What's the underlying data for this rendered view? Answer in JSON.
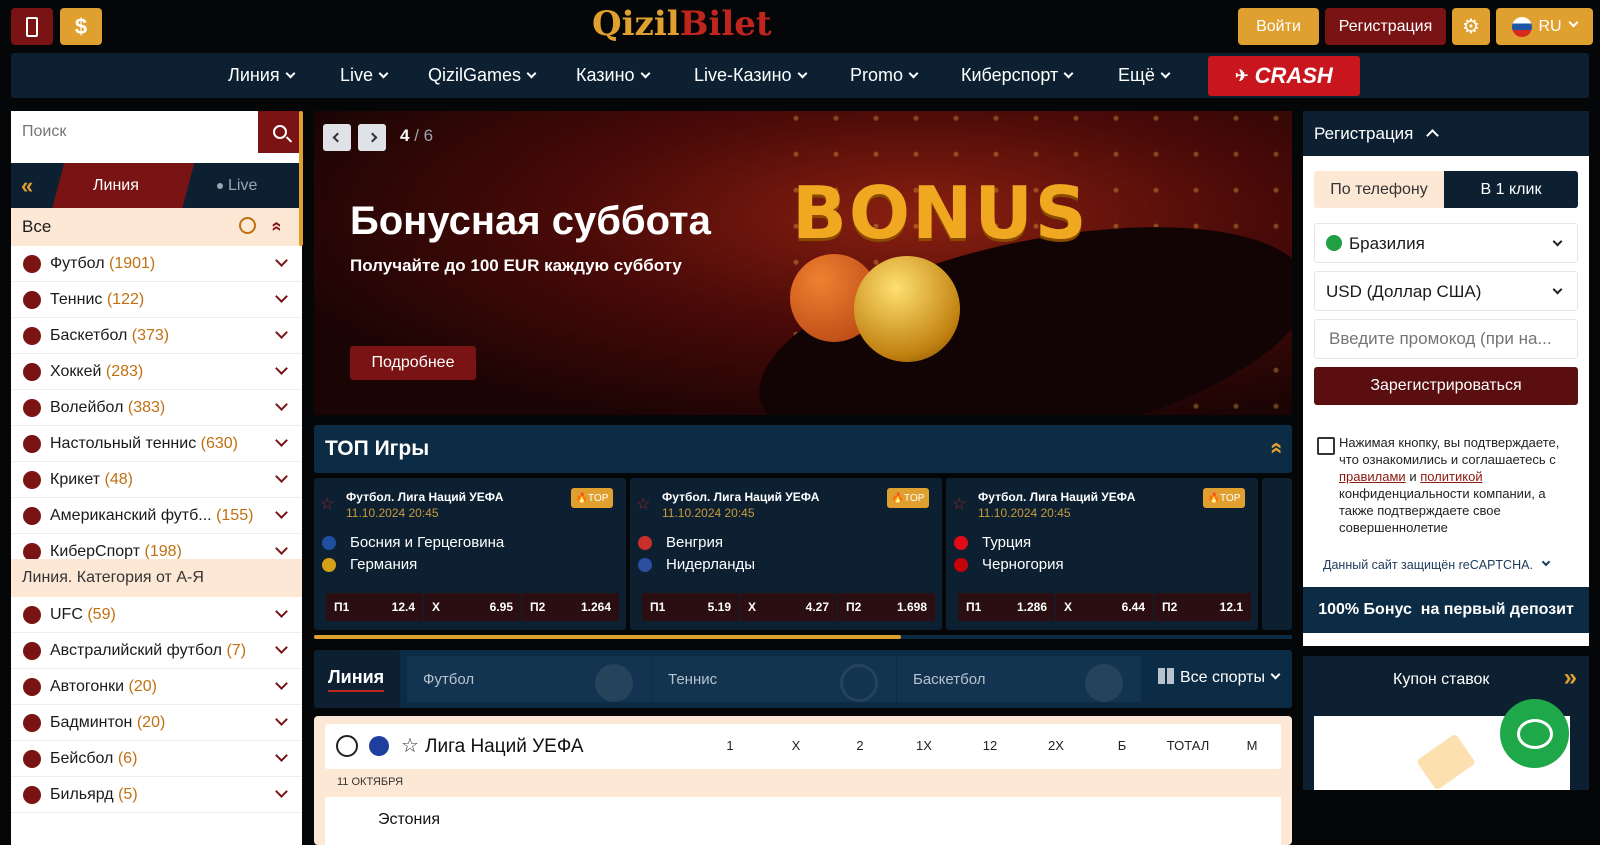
{
  "header": {
    "logo_part1": "Qizil",
    "logo_part2": "Bilet",
    "login": "Войти",
    "register": "Регистрация",
    "language": "RU",
    "colors": {
      "accent": "#e0a030",
      "brand_red": "#7a1414",
      "navy": "#0c2032"
    }
  },
  "nav": {
    "items": [
      "Линия",
      "Live",
      "QizilGames",
      "Казино",
      "Live-Казино",
      "Promo",
      "Киберспорт",
      "Ещё"
    ],
    "crash": "CRASH"
  },
  "sidebar": {
    "search_placeholder": "Поиск",
    "tab_line": "Линия",
    "tab_live": "Live",
    "all": "Все",
    "sports": [
      {
        "name": "Футбол",
        "count": "(1901)",
        "icon": "football-icon"
      },
      {
        "name": "Теннис",
        "count": "(122)",
        "icon": "tennis-icon"
      },
      {
        "name": "Баскетбол",
        "count": "(373)",
        "icon": "basketball-icon"
      },
      {
        "name": "Хоккей",
        "count": "(283)",
        "icon": "hockey-icon"
      },
      {
        "name": "Волейбол",
        "count": "(383)",
        "icon": "volleyball-icon"
      },
      {
        "name": "Настольный теннис",
        "count": "(630)",
        "icon": "table-tennis-icon"
      },
      {
        "name": "Крикет",
        "count": "(48)",
        "icon": "cricket-icon"
      },
      {
        "name": "Американский футб...",
        "count": "(155)",
        "icon": "american-football-icon"
      },
      {
        "name": "КиберСпорт",
        "count": "(198)",
        "icon": "esports-icon"
      }
    ],
    "category_title": "Линия. Категория от А-Я",
    "categories": [
      {
        "name": "UFC",
        "count": "(59)",
        "icon": "ufc-icon"
      },
      {
        "name": "Австралийский футбол",
        "count": "(7)",
        "icon": "aussie-football-icon"
      },
      {
        "name": "Автогонки",
        "count": "(20)",
        "icon": "racing-icon"
      },
      {
        "name": "Бадминтон",
        "count": "(20)",
        "icon": "badminton-icon"
      },
      {
        "name": "Бейсбол",
        "count": "(6)",
        "icon": "baseball-icon"
      },
      {
        "name": "Бильярд",
        "count": "(5)",
        "icon": "billiards-icon"
      }
    ]
  },
  "banner": {
    "slide_current": "4",
    "slide_total": "/ 6",
    "title": "Бонусная суббота",
    "subtitle": "Получайте до 100 EUR каждую субботу",
    "button": "Подробнее",
    "art_text": "BONUS"
  },
  "top_games": {
    "title": "ТОП Игры",
    "progress": 0.6,
    "cards": [
      {
        "league": "Футбол. Лига Наций УЕФА",
        "date": "11.10.2024 20:45",
        "badge": "TOP",
        "team1": "Босния и Герцеговина",
        "team2": "Германия",
        "p1": "12.4",
        "x": "6.95",
        "p2": "1.264",
        "f1": "#1f4fa0",
        "f2": "#d4a017"
      },
      {
        "league": "Футбол. Лига Наций УЕФА",
        "date": "11.10.2024 20:45",
        "badge": "TOP",
        "team1": "Венгрия",
        "team2": "Нидерланды",
        "p1": "5.19",
        "x": "4.27",
        "p2": "1.698",
        "f1": "#c9302c",
        "f2": "#2b4ea0"
      },
      {
        "league": "Футбол. Лига Наций УЕФА",
        "date": "11.10.2024 20:45",
        "badge": "TOP",
        "team1": "Турция",
        "team2": "Черногория",
        "p1": "1.286",
        "x": "6.44",
        "p2": "12.1",
        "f1": "#e30a17",
        "f2": "#c40308"
      }
    ],
    "odds_labels": {
      "p1": "П1",
      "x": "X",
      "p2": "П2"
    }
  },
  "line": {
    "title": "Линия",
    "sports": [
      "Футбол",
      "Теннис",
      "Баскетбол"
    ],
    "all_sports": "Все спорты",
    "league": "Лига Наций УЕФА",
    "columns": [
      "1",
      "X",
      "2",
      "1X",
      "12",
      "2X",
      "Б",
      "ТОТАЛ",
      "М"
    ],
    "date": "11 ОКТЯБРЯ",
    "team": "Эстония"
  },
  "registration": {
    "title": "Регистрация",
    "tab_phone": "По телефону",
    "tab_oneclick": "В 1 клик",
    "country": "Бразилия",
    "currency": "USD (Доллар США)",
    "promo_placeholder": "Введите промокод (при на...",
    "submit": "Зарегистрироваться",
    "consent_1": "Нажимая кнопку, вы подтверждаете, что ознакомились и соглашаетесь с",
    "rules_link": "правилами",
    "and": "и",
    "policy_link": "политикой",
    "consent_2": "конфиденциальности компании, а также подтверждаете свое совершеннолетие",
    "recaptcha": "Данный сайт защищён reCAPTCHA.",
    "bonus": "100% Бонус  на первый депозит",
    "coupon": "Купон ставок"
  }
}
